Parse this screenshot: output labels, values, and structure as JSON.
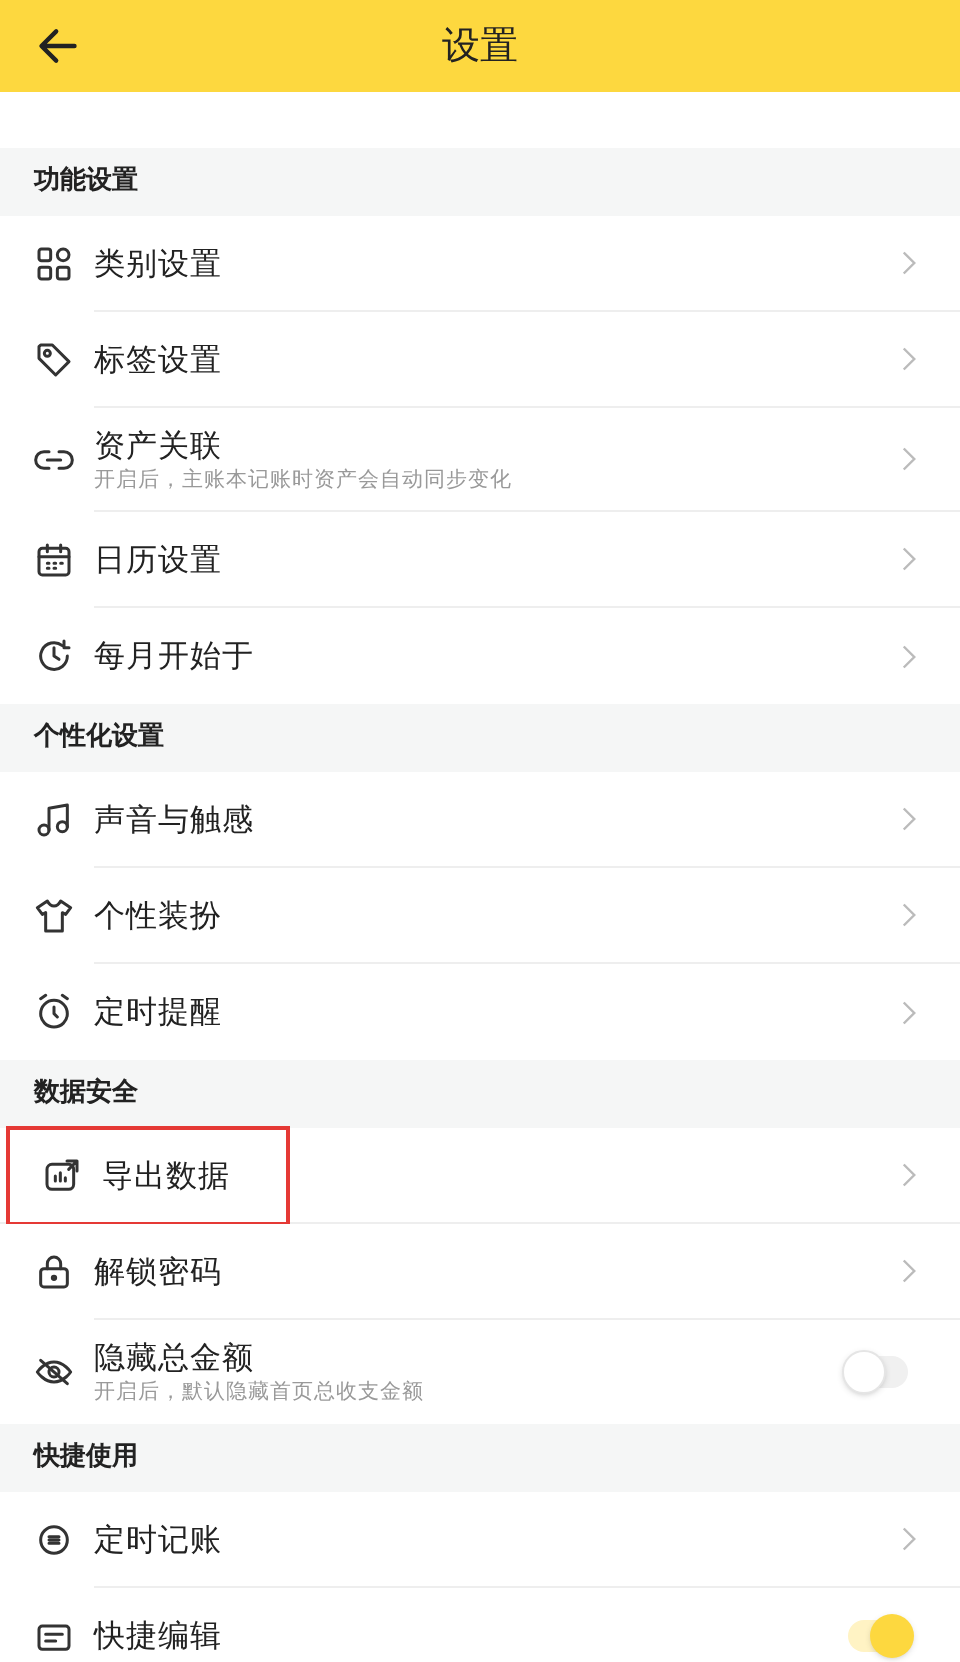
{
  "header": {
    "title": "设置"
  },
  "sections": [
    {
      "title": "功能设置",
      "items": [
        {
          "label": "类别设置",
          "kind": "link"
        },
        {
          "label": "标签设置",
          "kind": "link"
        },
        {
          "label": "资产关联",
          "subtitle": "开启后，主账本记账时资产会自动同步变化",
          "kind": "link"
        },
        {
          "label": "日历设置",
          "kind": "link"
        },
        {
          "label": "每月开始于",
          "kind": "link"
        }
      ]
    },
    {
      "title": "个性化设置",
      "items": [
        {
          "label": "声音与触感",
          "kind": "link"
        },
        {
          "label": "个性装扮",
          "kind": "link"
        },
        {
          "label": "定时提醒",
          "kind": "link"
        }
      ]
    },
    {
      "title": "数据安全",
      "items": [
        {
          "label": "导出数据",
          "kind": "link",
          "highlighted": true
        },
        {
          "label": "解锁密码",
          "kind": "link"
        },
        {
          "label": "隐藏总金额",
          "subtitle": "开启后，默认隐藏首页总收支金额",
          "kind": "toggle",
          "on": false
        }
      ]
    },
    {
      "title": "快捷使用",
      "items": [
        {
          "label": "定时记账",
          "kind": "link"
        },
        {
          "label": "快捷编辑",
          "kind": "toggle",
          "on": true
        }
      ]
    }
  ]
}
